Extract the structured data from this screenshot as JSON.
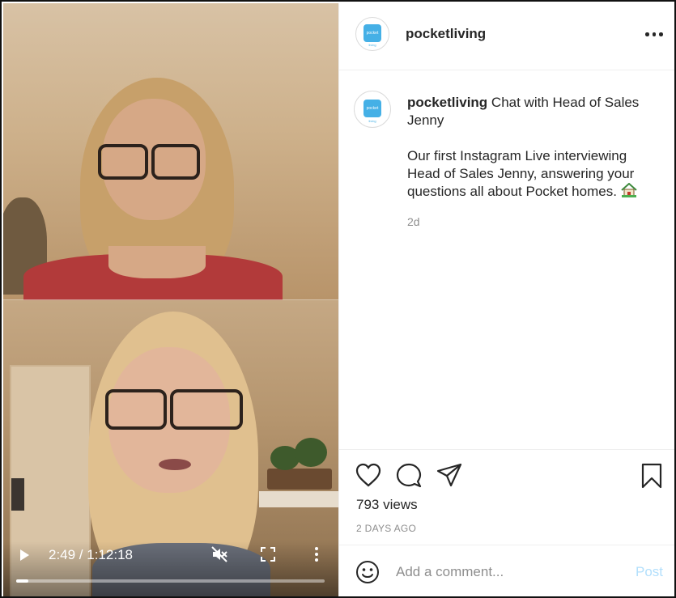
{
  "header": {
    "username": "pocketliving",
    "avatar_logo_text": "pocket",
    "avatar_logo_sub": "living"
  },
  "caption": {
    "username": "pocketliving",
    "title": "Chat with Head of Sales Jenny",
    "body": "Our first Instagram Live interviewing Head of Sales Jenny, answering your questions all about Pocket homes.",
    "emoji_icon": "house-with-garden-icon",
    "age": "2d"
  },
  "video": {
    "time_display": "2:49 / 1:12:18",
    "progress_fraction": 0.039,
    "muted": true
  },
  "stats": {
    "views": "793 views",
    "posted": "2 DAYS AGO"
  },
  "comment": {
    "placeholder": "Add a comment...",
    "post_label": "Post",
    "post_color": "#b2dffc"
  },
  "colors": {
    "brand_logo": "#45b0e6",
    "muted_text": "#8e8e8e"
  }
}
